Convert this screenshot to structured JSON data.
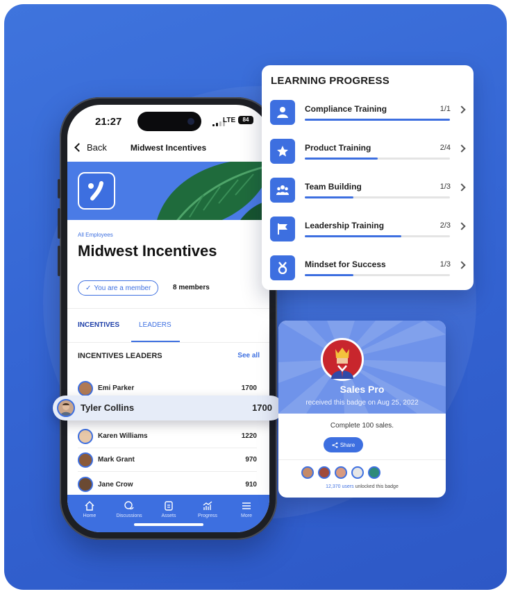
{
  "phone": {
    "status": {
      "time": "21:27",
      "network": "LTE",
      "battery": "84"
    },
    "nav": {
      "back_label": "Back",
      "title": "Midwest Incentives"
    },
    "group": {
      "subtitle": "All Employees",
      "title": "Midwest Incentives",
      "member_status": "You are a member",
      "member_count": "8 members"
    },
    "tabs": [
      {
        "label": "INCENTIVES"
      },
      {
        "label": "LEADERS"
      }
    ],
    "leaders": {
      "heading": "INCENTIVES LEADERS",
      "see_all": "See all",
      "rows": [
        {
          "name": "Emi Parker",
          "score": "1700",
          "avatar_color": "#b07a55"
        },
        {
          "name": "Tyler Collins",
          "score": "1700",
          "avatar_color": "#c9a58a"
        },
        {
          "name": "Karen Williams",
          "score": "1220",
          "avatar_color": "#e8c8a8"
        },
        {
          "name": "Mark Grant",
          "score": "970",
          "avatar_color": "#8a5a3a"
        },
        {
          "name": "Jane Crow",
          "score": "910",
          "avatar_color": "#6b4a33"
        }
      ]
    },
    "tabbar": [
      {
        "label": "Home",
        "icon": "home-icon"
      },
      {
        "label": "Discussions",
        "icon": "chat-bubbles-icon"
      },
      {
        "label": "Assets",
        "icon": "document-icon"
      },
      {
        "label": "Progress",
        "icon": "progress-chart-icon"
      },
      {
        "label": "More",
        "icon": "menu-icon"
      }
    ]
  },
  "highlighted_leader": {
    "name": "Tyler Collins",
    "score": "1700"
  },
  "learning_progress": {
    "title": "LEARNING PROGRESS",
    "items": [
      {
        "name": "Compliance Training",
        "count": "1/1",
        "progress": 1.0,
        "icon": "person-icon"
      },
      {
        "name": "Product Training",
        "count": "2/4",
        "progress": 0.5,
        "icon": "star-icon"
      },
      {
        "name": "Team Building",
        "count": "1/3",
        "progress": 0.333,
        "icon": "team-icon"
      },
      {
        "name": "Leadership Training",
        "count": "2/3",
        "progress": 0.667,
        "icon": "flag-icon"
      },
      {
        "name": "Mindset for Success",
        "count": "1/3",
        "progress": 0.333,
        "icon": "medal-icon"
      }
    ]
  },
  "badge": {
    "name": "Sales Pro",
    "received": "received this badge on Aug 25, 2022",
    "description": "Complete 100 sales.",
    "share_label": "Share",
    "users_count": "12,370 users",
    "users_suffix": " unlocked this badge",
    "user_avatar_colors": [
      "#c58b6a",
      "#a04a3a",
      "#d89a80",
      "#e6e6e6",
      "#2e8a7a"
    ]
  },
  "colors": {
    "accent": "#3d6fe0",
    "background": "#3566d4"
  }
}
